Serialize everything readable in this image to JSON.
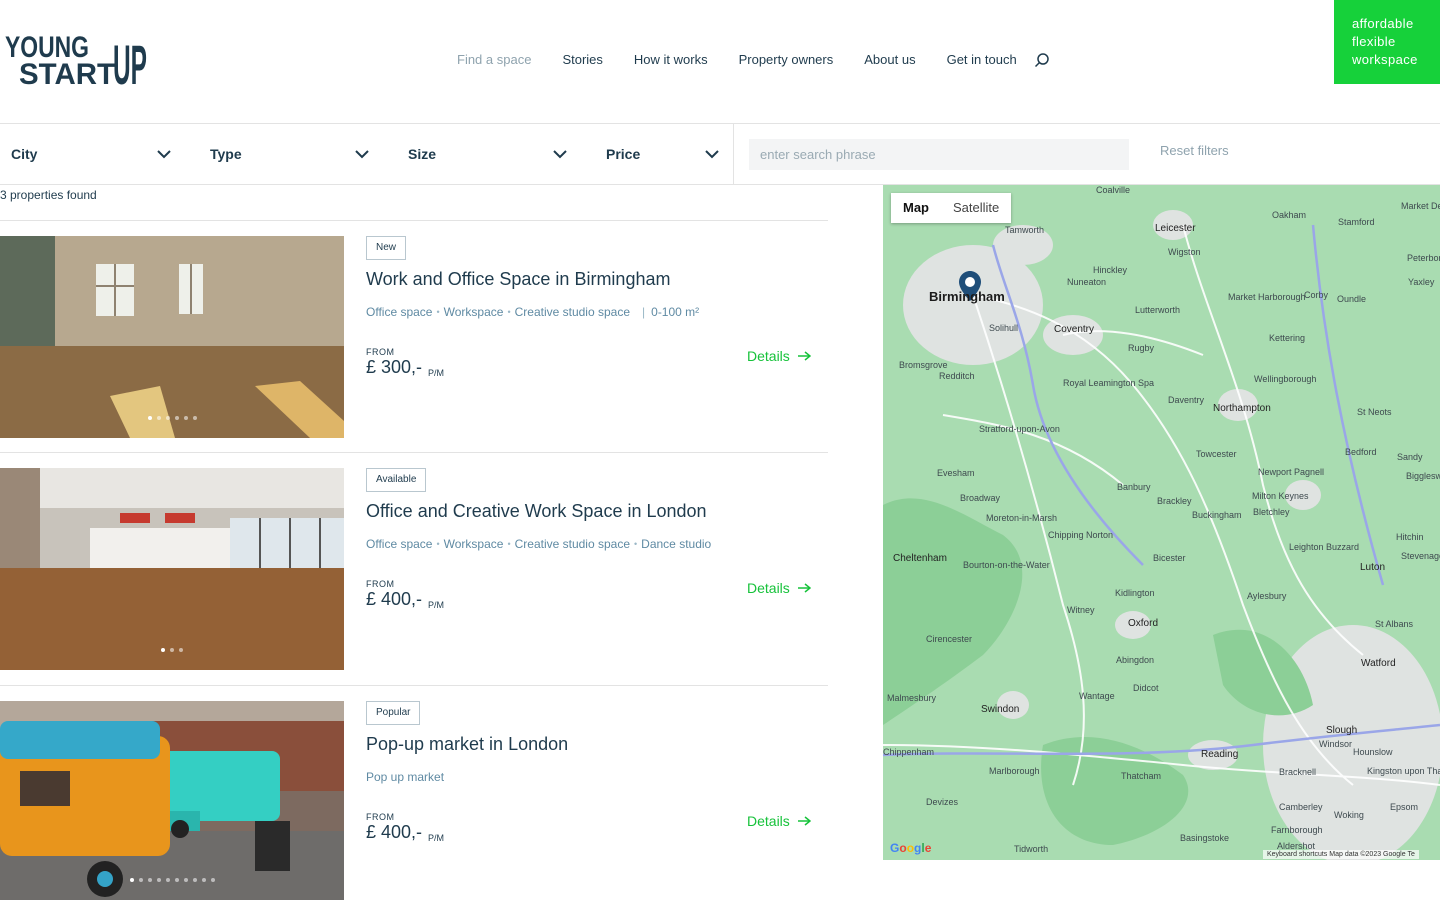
{
  "brand": {
    "logo_top": "YOUNG",
    "logo_bottom": "START",
    "logo_up": "UP",
    "tagline": [
      "affordable",
      "flexible",
      "workspace"
    ],
    "accent": "#16d13a"
  },
  "nav": {
    "items": [
      "Find a space",
      "Stories",
      "How it works",
      "Property owners",
      "About us",
      "Get in touch"
    ]
  },
  "filters": {
    "city": "City",
    "type": "Type",
    "size": "Size",
    "price": "Price",
    "search_placeholder": "enter search phrase",
    "reset": "Reset filters"
  },
  "results": {
    "count_text": "3 properties found"
  },
  "listings": [
    {
      "badge": "New",
      "title": "Work and Office Space in Birmingham",
      "tags": [
        "Office space",
        "Workspace",
        "Creative studio space"
      ],
      "size": "0-100 m²",
      "from_label": "FROM",
      "price": "£ 300,-",
      "unit": "P/M",
      "details": "Details",
      "photo_count": 6,
      "photo_active": 0
    },
    {
      "badge": "Available",
      "title": "Office and Creative Work Space in London",
      "tags": [
        "Office space",
        "Workspace",
        "Creative studio space",
        "Dance studio"
      ],
      "size": "",
      "from_label": "FROM",
      "price": "£ 400,-",
      "unit": "P/M",
      "details": "Details",
      "photo_count": 3,
      "photo_active": 0
    },
    {
      "badge": "Popular",
      "title": "Pop-up market in London",
      "tags": [
        "Pop up market"
      ],
      "size": "",
      "from_label": "FROM",
      "price": "£ 400,-",
      "unit": "P/M",
      "details": "Details",
      "photo_count": 10,
      "photo_active": 0
    }
  ],
  "map": {
    "mode_map": "Map",
    "mode_satellite": "Satellite",
    "google": "Google",
    "footer": "Keyboard shortcuts   Map data ©2023 Google   Te",
    "places": [
      "Birmingham",
      "Coventry",
      "Leicester",
      "Northampton",
      "Oxford",
      "Reading",
      "Swindon",
      "Luton",
      "Watford",
      "Slough",
      "Cheltenham",
      "Milton Keynes",
      "Banbury",
      "Rugby",
      "Daventry",
      "Tamworth",
      "Nuneaton",
      "Hinckley",
      "Redditch",
      "Evesham",
      "Bicester",
      "Aylesbury",
      "Abingdon",
      "Didcot",
      "Wantage",
      "Cirencester",
      "Malmesbury",
      "Chippenham",
      "Marlborough",
      "Bedford",
      "Kettering",
      "Corby",
      "Oakham",
      "Stamford",
      "Witney",
      "Kidlington",
      "Towcester",
      "Wellingborough",
      "St Neots",
      "Hitchin",
      "Stevenage",
      "Buckingham",
      "Brackley",
      "Bletchley",
      "St Albans",
      "Bracknell",
      "Camberley",
      "Woking",
      "Newport Pagnell",
      "Sandy",
      "Solihull",
      "Lutterworth",
      "Market Harborough",
      "Wigston",
      "Oundle",
      "Royal Leamington Spa",
      "Stratford-upon-Avon",
      "Chipping Norton",
      "Bourton-on-the-Water",
      "Thatcham",
      "Basingstoke",
      "Farnborough",
      "Devizes",
      "Hounslow",
      "Windsor",
      "Kingston upon Thames",
      "Epsom",
      "Leighton Buzzard",
      "Broadway",
      "Moreton-in-Marsh",
      "Bromsgrove",
      "Coalville",
      "Market Deeping",
      "Peterborough",
      "Yaxley",
      "Biggleswade",
      "Aldershot",
      "Tidworth"
    ]
  }
}
